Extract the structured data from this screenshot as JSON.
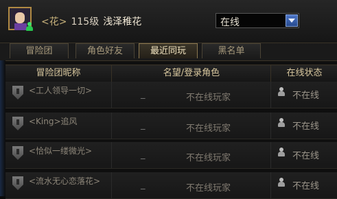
{
  "header": {
    "guild_tag": "<花>",
    "level": "115级",
    "player_name": "浅泽稚花",
    "status_value": "在线"
  },
  "tabs": [
    {
      "label": "冒险团"
    },
    {
      "label": "角色好友"
    },
    {
      "label": "最近同玩",
      "active": true
    },
    {
      "label": "黑名单"
    }
  ],
  "table": {
    "columns": [
      "冒险团昵称",
      "名望/登录角色",
      "在线状态"
    ],
    "rows": [
      {
        "name": "<工人领导一切>",
        "fame": "_",
        "role": "不在线玩家",
        "status": "不在线"
      },
      {
        "name": "<King>追风",
        "fame": "_",
        "role": "不在线玩家",
        "status": "不在线"
      },
      {
        "name": "<恰似一缕微光>",
        "fame": "_",
        "role": "不在线玩家",
        "status": "不在线"
      },
      {
        "name": "<流水无心恋落花>",
        "fame": "_",
        "role": "不在线玩家",
        "status": "不在线"
      }
    ]
  }
}
